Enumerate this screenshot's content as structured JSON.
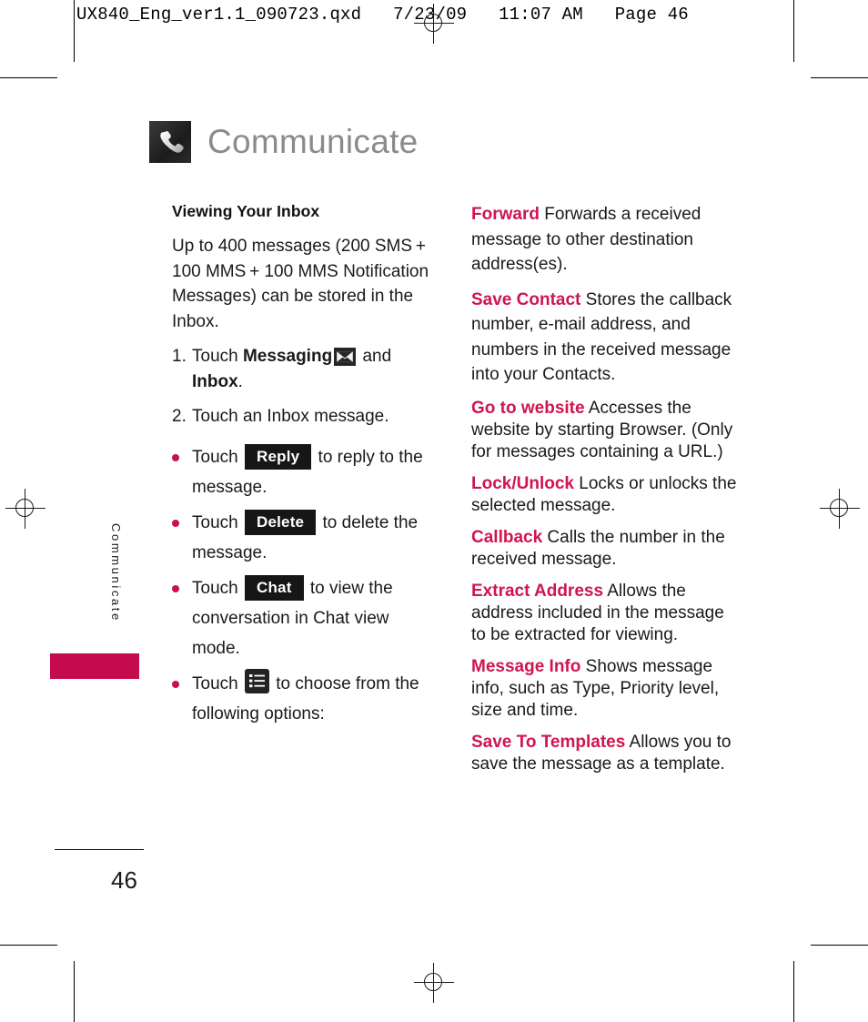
{
  "prepress": {
    "header": "UX840_Eng_ver1.1_090723.qxd   7/23/09   11:07 AM   Page 46"
  },
  "title": {
    "text": "Communicate",
    "icon": "phone-handset-icon"
  },
  "side_tab": {
    "label": "Communicate",
    "color": "#c30b4e"
  },
  "left_column": {
    "heading": "Viewing Your Inbox",
    "intro": "Up to 400 messages (200 SMS + 100 MMS + 100 MMS Notification Messages) can be stored in the Inbox.",
    "steps": [
      {
        "num": "1.",
        "pre": "Touch ",
        "strong1": "Messaging",
        "icon": "envelope-icon",
        "mid": " and ",
        "strong2": "Inbox",
        "post": "."
      },
      {
        "num": "2.",
        "pre": "Touch an Inbox message.",
        "strong1": "",
        "icon": "",
        "mid": "",
        "strong2": "",
        "post": ""
      }
    ],
    "bullets": [
      {
        "pre": "Touch ",
        "chip": "Reply",
        "post": " to reply to the message.",
        "icon": ""
      },
      {
        "pre": "Touch ",
        "chip": "Delete",
        "post": " to delete the message.",
        "icon": ""
      },
      {
        "pre": "Touch ",
        "chip": "Chat",
        "post": " to view the conversation in Chat view mode.",
        "icon": ""
      },
      {
        "pre": "Touch ",
        "chip": "",
        "post": " to choose from the following options:",
        "icon": "options-list-icon"
      }
    ]
  },
  "right_column": {
    "options": [
      {
        "term": "Forward",
        "desc": " Forwards a received message to other destination address(es)."
      },
      {
        "term": "Save Contact",
        "desc": " Stores the callback number, e-mail address, and numbers in the received message into your Contacts."
      },
      {
        "term": "Go to website",
        "desc": "  Accesses the website by starting Browser. (Only for messages containing a URL.)"
      },
      {
        "term": "Lock/Unlock",
        "desc": " Locks or unlocks the selected message."
      },
      {
        "term": "Callback",
        "desc": " Calls the number in the received message."
      },
      {
        "term": "Extract Address",
        "desc": " Allows the address included in the message to be extracted for viewing."
      },
      {
        "term": "Message Info",
        "desc": " Shows message info, such as Type, Priority level, size and time."
      },
      {
        "term": "Save To Templates",
        "desc": " Allows you to save the message as a template."
      }
    ]
  },
  "footer": {
    "page_number": "46"
  }
}
